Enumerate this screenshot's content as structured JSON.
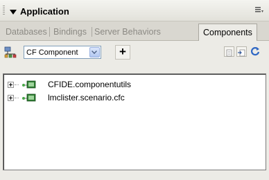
{
  "panel": {
    "title": "Application"
  },
  "tabs": [
    {
      "label": "Databases",
      "active": false
    },
    {
      "label": "Bindings",
      "active": false
    },
    {
      "label": "Server Behaviors",
      "active": false
    },
    {
      "label": "Components",
      "active": true
    }
  ],
  "toolbar": {
    "component_type": "CF Component",
    "add_label": "+"
  },
  "tree": {
    "items": [
      {
        "label": "CFIDE.componentutils"
      },
      {
        "label": "lmclister.scenario.cfc"
      }
    ]
  },
  "colors": {
    "background": "#ecebe6",
    "tab_inactive_text": "#8c8a84",
    "combo_border": "#7f9db9"
  }
}
